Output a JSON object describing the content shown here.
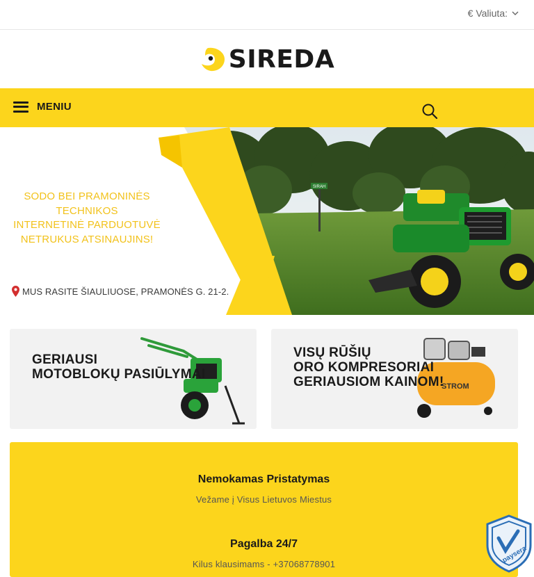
{
  "topbar": {
    "currency_label": "€ Valiuta:"
  },
  "logo": {
    "text": "SIREDA"
  },
  "nav": {
    "menu_label": "MENIU"
  },
  "hero": {
    "lines": [
      "SODO BEI PRAMONINĖS",
      "TECHNIKOS",
      "INTERNETINĖ PARDUOTUVĖ",
      "NETRUKUS ATSINAUJINS!"
    ],
    "address": "MUS RASITE ŠIAULIUOSE, PRAMONĖS G. 21-2.",
    "sign_text": "SIRAH"
  },
  "cards": [
    {
      "lines": [
        "GERIAUSI",
        "MOTOBLOKŲ PASIŪLYMAI"
      ]
    },
    {
      "lines": [
        "VISŲ RŪŠIŲ",
        "ORO KOMPRESORIAI",
        "GERIAUSIOM KAINOM!"
      ],
      "brand_text": "STROM"
    }
  ],
  "info": [
    {
      "title": "Nemokamas Pristatymas",
      "subtitle": "Vežame į Visus Lietuvos Miestus"
    },
    {
      "title": "Pagalba 24/7",
      "subtitle": "Kilus klausimams - +37068778901"
    }
  ],
  "badge": {
    "text": "paysera"
  },
  "colors": {
    "brand_yellow": "#fcd51c",
    "hero_yellow": "#f2c21b",
    "dark": "#1a1a1a"
  },
  "icons": [
    "chevron-down-icon",
    "hamburger-icon",
    "search-icon",
    "map-pin-icon",
    "shield-icon"
  ]
}
